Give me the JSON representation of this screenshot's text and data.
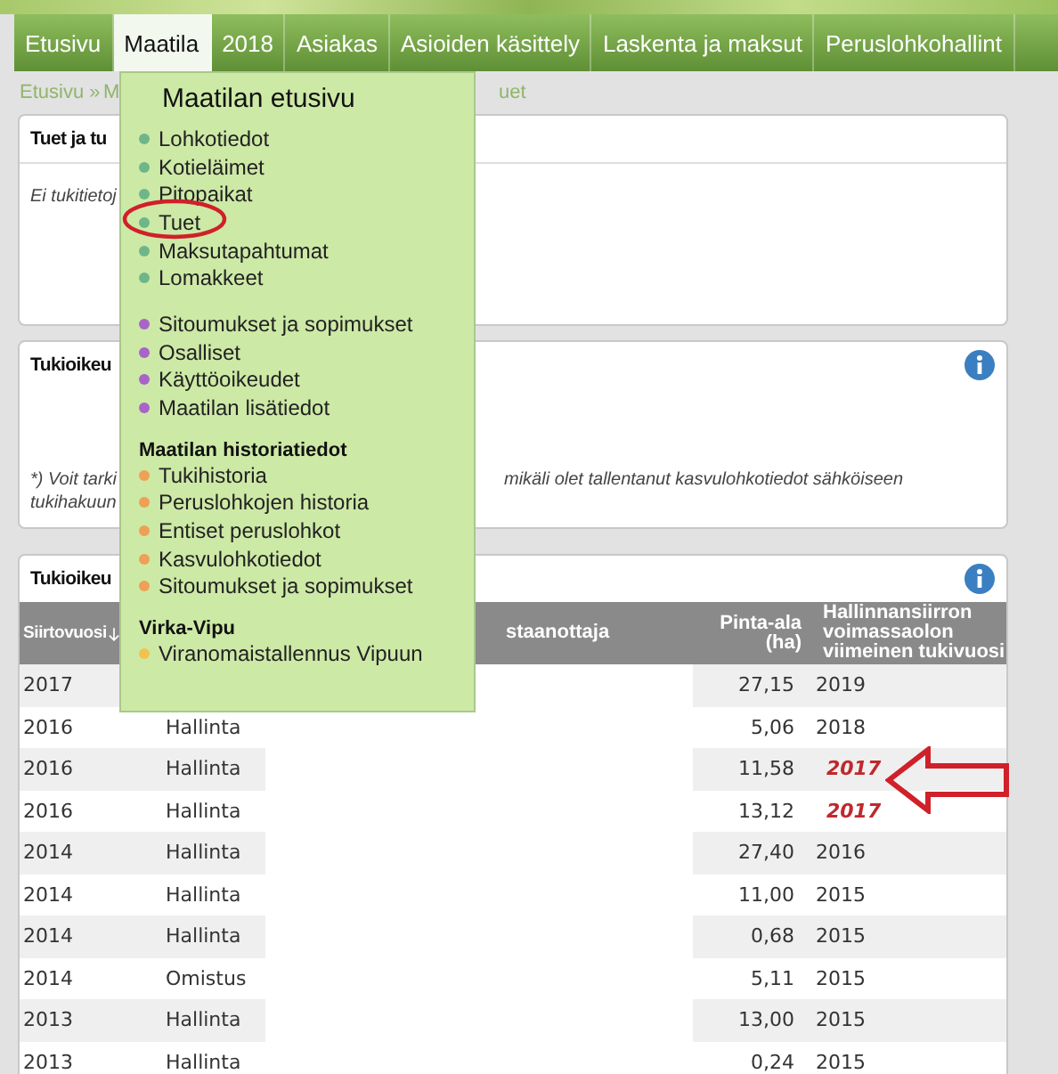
{
  "nav": [
    {
      "label": "Etusivu",
      "selected": false
    },
    {
      "label": "Maatila",
      "selected": true
    },
    {
      "label": "2018",
      "selected": false
    },
    {
      "label": "Asiakas",
      "selected": false
    },
    {
      "label": "Asioiden käsittely",
      "selected": false
    },
    {
      "label": "Laskenta ja maksut",
      "selected": false
    },
    {
      "label": "Peruslohkohallint",
      "selected": false
    }
  ],
  "breadcrumb": {
    "first": "Etusivu »",
    "second": "M",
    "last": "uet"
  },
  "panel_support": {
    "title": "Tuet ja tu",
    "message": "Ei tukitietoj"
  },
  "panel_rights_note": {
    "title": "Tukioikeu",
    "note_left_1": "*) Voit tarki",
    "note_right_1": "mikäli olet tallentanut kasvulohkotiedot sähköiseen",
    "note_left_2": "tukihakuun"
  },
  "panel_transfers": {
    "title": "Tukioikeu",
    "columns": [
      {
        "label": "Siirtovuosi",
        "sorted": true
      },
      {
        "label": "staanottaja",
        "sorted": false
      },
      {
        "label": "Pinta-ala (ha)",
        "sorted": false
      },
      {
        "label": "Hallinnansiirron voimassaolon viimeinen tukivuosi",
        "sorted": false
      }
    ],
    "rows": [
      {
        "year": "2017",
        "area": "27,15",
        "last_year": "2019",
        "flagged": false
      },
      {
        "year": "2016",
        "type": "Hallinta",
        "area": "5,06",
        "last_year": "2018",
        "flagged": false
      },
      {
        "year": "2016",
        "type": "Hallinta",
        "area": "11,58",
        "last_year": "2017",
        "flagged": true
      },
      {
        "year": "2016",
        "type": "Hallinta",
        "area": "13,12",
        "last_year": "2017",
        "flagged": true
      },
      {
        "year": "2014",
        "type": "Hallinta",
        "area": "27,40",
        "last_year": "2016",
        "flagged": false
      },
      {
        "year": "2014",
        "type": "Hallinta",
        "area": "11,00",
        "last_year": "2015",
        "flagged": false
      },
      {
        "year": "2014",
        "type": "Hallinta",
        "area": "0,68",
        "last_year": "2015",
        "flagged": false
      },
      {
        "year": "2014",
        "type": "Omistus",
        "area": "5,11",
        "last_year": "2015",
        "flagged": false
      },
      {
        "year": "2013",
        "type": "Hallinta",
        "area": "13,00",
        "last_year": "2015",
        "flagged": false
      },
      {
        "year": "2013",
        "type": "Hallinta",
        "area": "0,24",
        "last_year": "2015",
        "flagged": false
      }
    ]
  },
  "menu": {
    "title": "Maatilan etusivu",
    "groups": [
      {
        "items": [
          {
            "label": "Lohkotiedot",
            "color": "#6fb58a",
            "circled": false
          },
          {
            "label": "Kotieläimet",
            "color": "#6fb58a",
            "circled": false
          },
          {
            "label": "Pitopaikat",
            "color": "#6fb58a",
            "circled": false
          },
          {
            "label": "Tuet",
            "color": "#6fb58a",
            "circled": true
          },
          {
            "label": "Maksutapahtumat",
            "color": "#6fb58a",
            "circled": false
          },
          {
            "label": "Lomakkeet",
            "color": "#6fb58a",
            "circled": false
          }
        ]
      },
      {
        "items": [
          {
            "label": "Sitoumukset ja sopimukset",
            "color": "#a864c8",
            "circled": false
          },
          {
            "label": "Osalliset",
            "color": "#a864c8",
            "circled": false
          },
          {
            "label": "Käyttöoikeudet",
            "color": "#a864c8",
            "circled": false
          },
          {
            "label": "Maatilan lisätiedot",
            "color": "#a864c8",
            "circled": false
          }
        ]
      },
      {
        "heading": "Maatilan historiatiedot",
        "items": [
          {
            "label": "Tukihistoria",
            "color": "#eea055",
            "circled": false
          },
          {
            "label": "Peruslohkojen historia",
            "color": "#eea055",
            "circled": false
          },
          {
            "label": "Entiset peruslohkot",
            "color": "#eea055",
            "circled": false
          },
          {
            "label": "Kasvulohkotiedot",
            "color": "#eea055",
            "circled": false
          },
          {
            "label": "Sitoumukset ja sopimukset",
            "color": "#eea055",
            "circled": false
          }
        ]
      },
      {
        "heading": "Virka-Vipu",
        "items": [
          {
            "label": "Viranomaistallennus Vipuun",
            "color": "#f2c24e",
            "circled": false
          }
        ]
      }
    ]
  }
}
